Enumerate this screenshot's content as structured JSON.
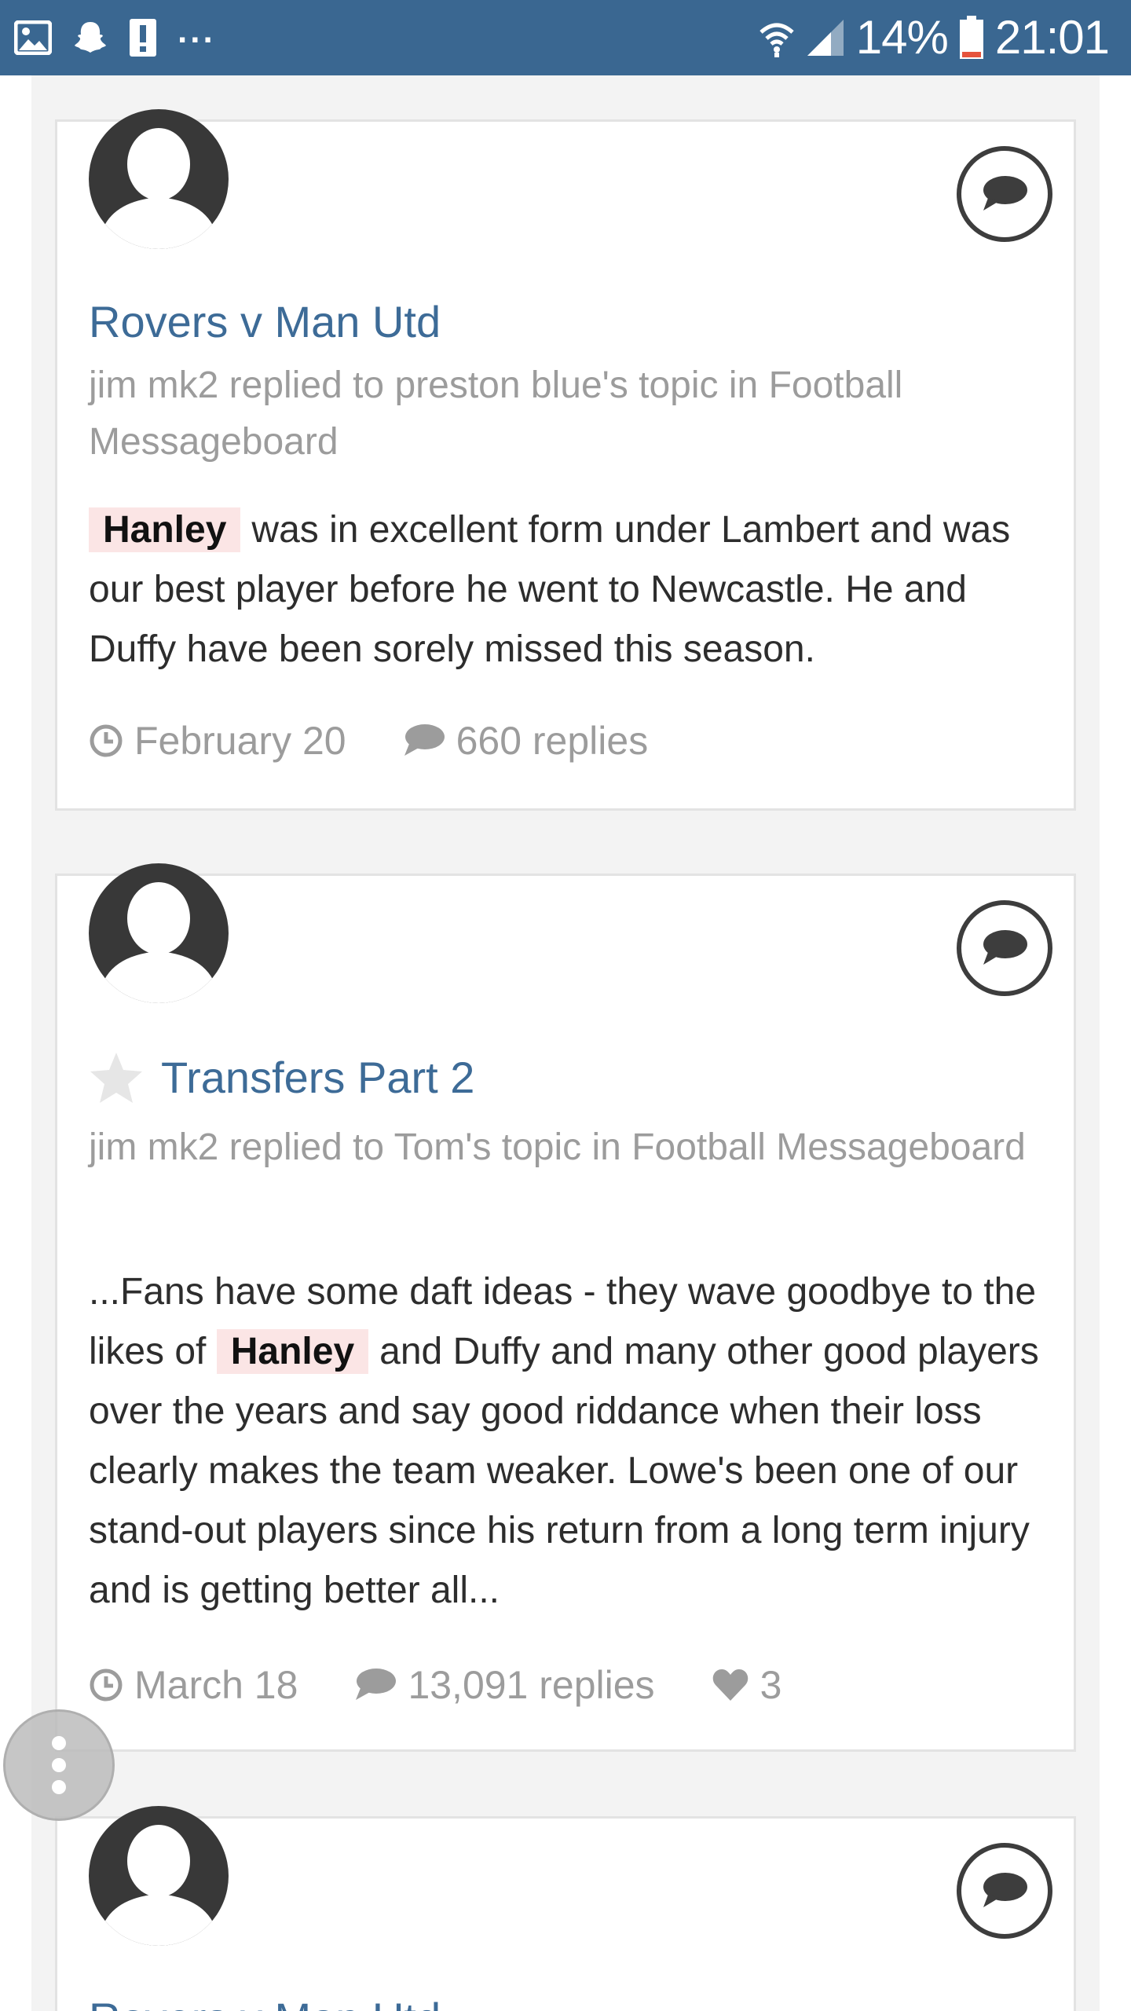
{
  "status_bar": {
    "notification_icons": [
      "gallery-icon",
      "snapchat-icon",
      "alert-icon"
    ],
    "more_indicator": "...",
    "battery_percent": "14%",
    "time": "21:01",
    "background_color": "#3a6791"
  },
  "posts": [
    {
      "title": "Rovers v Man Utd",
      "starred": false,
      "meta": "jim mk2 replied to preston blue's topic in Football Messageboard",
      "snippet_before": "",
      "highlight": "Hanley",
      "snippet_after": "was in excellent form under Lambert and was our best player before he went to Newcastle. He and Duffy have been sorely missed this season.",
      "date": "February 20",
      "replies": "660 replies",
      "likes": ""
    },
    {
      "title": "Transfers Part 2",
      "starred": true,
      "meta": "jim mk2 replied to Tom's topic in Football Messageboard",
      "snippet_before": "...Fans have some daft ideas - they wave goodbye to the likes of",
      "highlight": "Hanley",
      "snippet_after": "and Duffy and many other good players over the years and say good riddance when their loss clearly makes the team weaker. Lowe's been one of our stand-out players since his return from a long term injury and is getting better all...",
      "date": "March 18",
      "replies": "13,091 replies",
      "likes": "3"
    },
    {
      "title": "Rovers v Man Utd"
    }
  ],
  "colors": {
    "link": "#3d6b97",
    "highlight_bg": "#fbe5e5",
    "meta_text": "#9c9c9c"
  }
}
